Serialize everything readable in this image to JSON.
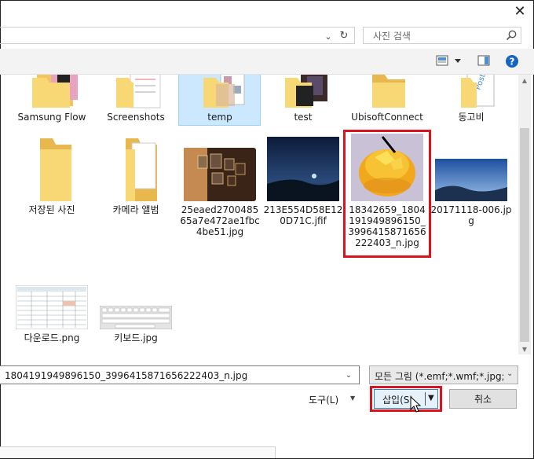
{
  "window": {
    "close_icon_glyph": "✕"
  },
  "address": {
    "chevron": "⌄",
    "refresh": "↻"
  },
  "search": {
    "placeholder": "사진 검색"
  },
  "files": [
    {
      "label": "Samsung Flow",
      "type": "folder-photo"
    },
    {
      "label": "Screenshots",
      "type": "folder-doc"
    },
    {
      "label": "temp",
      "type": "folder-photo",
      "selected": true
    },
    {
      "label": "test",
      "type": "folder-photo"
    },
    {
      "label": "UbisoftConnect",
      "type": "folder"
    },
    {
      "label": "동고비",
      "type": "folder-doc"
    },
    {
      "label": "저장된 사진",
      "type": "folder"
    },
    {
      "label": "카메라 앨범",
      "type": "folder-doc"
    },
    {
      "label": "25eaed270048565a7e472ae1fbc4be51.jpg",
      "type": "image-gallery"
    },
    {
      "label": "213E554D58E120D71C.jfif",
      "type": "image-night"
    },
    {
      "label": "18342659_1804191949896150_3996415871656222403_n.jpg",
      "type": "image-jelly",
      "highlighted": true
    },
    {
      "label": "20171118-006.jpg",
      "type": "image-mountain"
    },
    {
      "label": "다운로드.png",
      "type": "image-sheet"
    },
    {
      "label": "키보드.jpg",
      "type": "image-keyboard"
    }
  ],
  "filename": {
    "value": "1804191949896150_3996415871656222403_n.jpg"
  },
  "filetype": {
    "value": "모든 그림 (*.emf;*.wmf;*.jpg;*."
  },
  "buttons": {
    "tools_label": "도구(L)",
    "insert_label": "삽입(S)",
    "cancel_label": "취소"
  },
  "colors": {
    "selection": "#cce8ff",
    "highlight_border": "#d9141e",
    "folder": "#f8d775",
    "accent": "#0078d7"
  }
}
